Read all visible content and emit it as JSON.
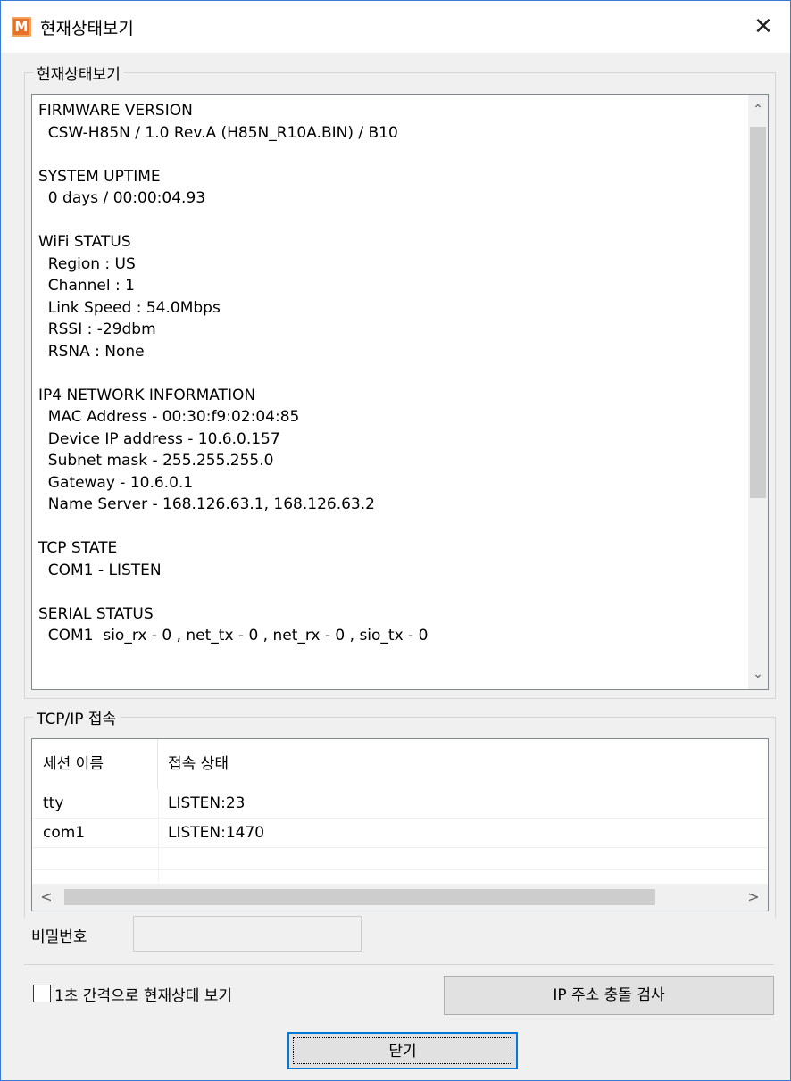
{
  "window": {
    "title": "현재상태보기",
    "icon_letter": "M",
    "close_glyph": "✕"
  },
  "status_group": {
    "label": "현재상태보기",
    "lines": [
      "FIRMWARE VERSION",
      "  CSW-H85N / 1.0 Rev.A (H85N_R10A.BIN) / B10",
      "",
      "SYSTEM UPTIME",
      "  0 days / 00:00:04.93",
      "",
      "WiFi STATUS",
      "  Region : US",
      "  Channel : 1",
      "  Link Speed : 54.0Mbps",
      "  RSSI : -29dbm",
      "  RSNA : None",
      "",
      "IP4 NETWORK INFORMATION",
      "  MAC Address - 00:30:f9:02:04:85",
      "  Device IP address - 10.6.0.157",
      "  Subnet mask - 255.255.255.0",
      "  Gateway - 10.6.0.1",
      "  Name Server - 168.126.63.1, 168.126.63.2",
      "",
      "TCP STATE",
      "  COM1 - LISTEN",
      "",
      "SERIAL STATUS",
      "  COM1  sio_rx - 0 , net_tx - 0 , net_rx - 0 , sio_tx - 0"
    ],
    "scroll_up": "⌃",
    "scroll_down": "⌄"
  },
  "tcp_group": {
    "label": "TCP/IP 접속",
    "columns": [
      "세션 이름",
      "접속 상태"
    ],
    "rows": [
      {
        "session": "tty",
        "state": "LISTEN:23"
      },
      {
        "session": "com1",
        "state": "LISTEN:1470"
      }
    ],
    "scroll_left": "<",
    "scroll_right": ">"
  },
  "password": {
    "label": "비밀번호",
    "value": ""
  },
  "options": {
    "auto_refresh_label": "1초 간격으로 현재상태 보기",
    "auto_refresh_checked": false,
    "ip_conflict_button": "IP 주소 충돌 검사",
    "close_button": "닫기"
  },
  "colors": {
    "accent": "#0078d7",
    "app_icon": "#e8712a"
  }
}
